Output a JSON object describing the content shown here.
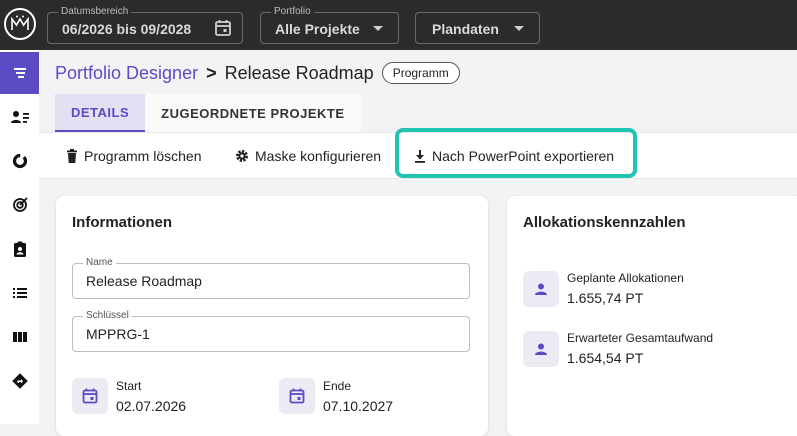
{
  "header": {
    "date_range": {
      "label": "Datumsbereich",
      "value": "06/2026 bis 09/2028"
    },
    "portfolio": {
      "label": "Portfolio",
      "value": "Alle Projekte"
    },
    "plan": {
      "value": "Plandaten"
    }
  },
  "sidebar": {
    "items": [
      {
        "icon": "roadmap-icon",
        "active": true
      },
      {
        "icon": "person-list-icon"
      },
      {
        "icon": "donut-chart-icon"
      },
      {
        "icon": "target-icon"
      },
      {
        "icon": "clipboard-person-icon"
      },
      {
        "icon": "list-icon"
      },
      {
        "icon": "columns-icon"
      },
      {
        "icon": "direction-sign-icon"
      }
    ]
  },
  "breadcrumb": {
    "parent": "Portfolio Designer",
    "separator": ">",
    "current": "Release Roadmap",
    "chip": "Programm"
  },
  "tabs": [
    {
      "label": "DETAILS",
      "active": true
    },
    {
      "label": "ZUGEORDNETE PROJEKTE",
      "active": false
    }
  ],
  "actions": {
    "delete": "Programm löschen",
    "configure": "Maske konfigurieren",
    "export": "Nach PowerPoint exportieren"
  },
  "info_card": {
    "title": "Informationen",
    "name_label": "Name",
    "name_value": "Release Roadmap",
    "key_label": "Schlüssel",
    "key_value": "MPPRG-1",
    "start_label": "Start",
    "start_value": "02.07.2026",
    "end_label": "Ende",
    "end_value": "07.10.2027"
  },
  "alloc_card": {
    "title": "Allokationskennzahlen",
    "planned_label": "Geplante Allokationen",
    "planned_value": "1.655,74 PT",
    "expected_label": "Erwarteter Gesamtaufwand",
    "expected_value": "1.654,54 PT"
  },
  "colors": {
    "accent": "#5b4bc4",
    "highlight": "#1fc4b3",
    "topbar": "#2b2b2b"
  }
}
